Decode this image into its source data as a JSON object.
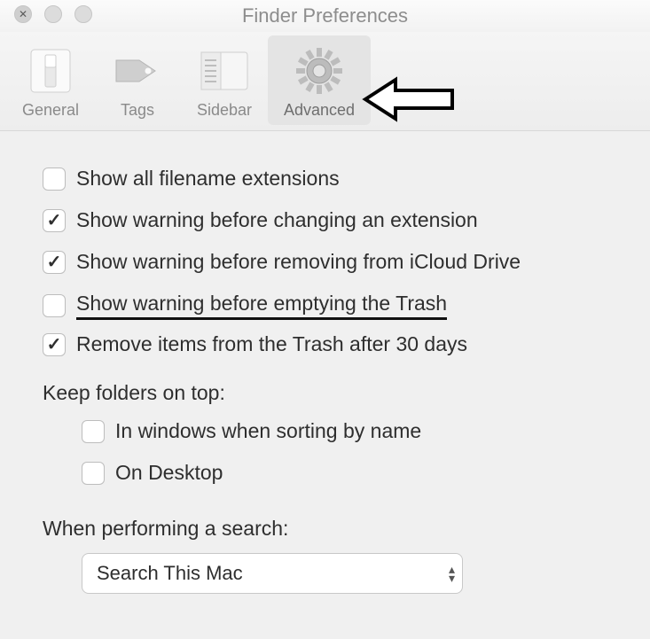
{
  "window": {
    "title": "Finder Preferences"
  },
  "tabs": {
    "general": "General",
    "tags": "Tags",
    "sidebar": "Sidebar",
    "advanced": "Advanced"
  },
  "options": {
    "show_extensions": {
      "label": "Show all filename extensions",
      "checked": false
    },
    "warn_extension": {
      "label": "Show warning before changing an extension",
      "checked": true
    },
    "warn_icloud": {
      "label": "Show warning before removing from iCloud Drive",
      "checked": true
    },
    "warn_trash": {
      "label": "Show warning before emptying the Trash",
      "checked": false
    },
    "remove_30": {
      "label": "Remove items from the Trash after 30 days",
      "checked": true
    }
  },
  "folders_section": {
    "heading": "Keep folders on top:",
    "in_windows": {
      "label": "In windows when sorting by name",
      "checked": false
    },
    "on_desktop": {
      "label": "On Desktop",
      "checked": false
    }
  },
  "search_section": {
    "heading": "When performing a search:",
    "selected": "Search This Mac"
  }
}
